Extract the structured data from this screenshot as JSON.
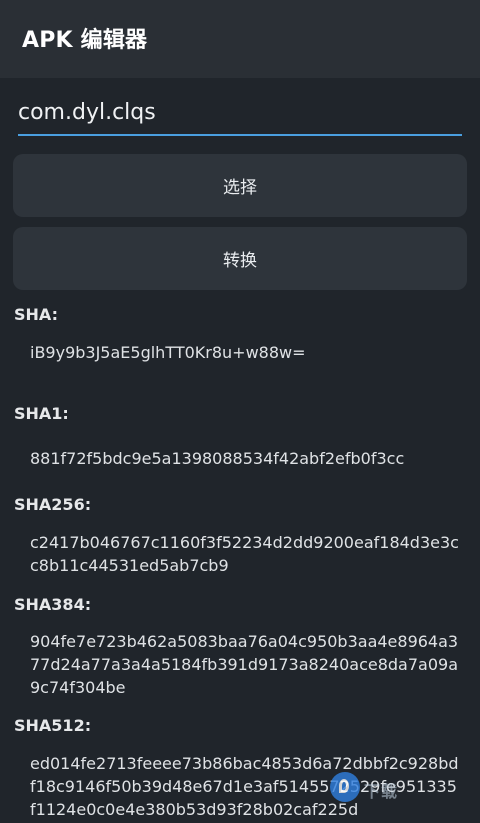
{
  "app_bar": {
    "title": "APK 编辑器"
  },
  "package_input": {
    "value": "com.dyl.clqs"
  },
  "buttons": {
    "select_label": "选择",
    "convert_label": "转换"
  },
  "hashes": [
    {
      "label": "SHA:",
      "value": "iB9y9b3J5aE5glhTT0Kr8u+w88w="
    },
    {
      "label": "SHA1:",
      "value": "881f72f5bdc9e5a1398088534f42abf2efb0f3cc"
    },
    {
      "label": "SHA256:",
      "value": "c2417b046767c1160f3f52234d2dd9200eaf184d3e3cc8b11c44531ed5ab7cb9"
    },
    {
      "label": "SHA384:",
      "value": "904fe7e723b462a5083baa76a04c950b3aa4e8964a377d24a77a3a4a5184fb391d9173a8240ace8da7a09a9c74f304be"
    },
    {
      "label": "SHA512:",
      "value": "ed014fe2713feeee73b86bac4853d6a72dbbf2c928bdf18c9146f50b39d48e67d1e3af5145572529fe951335f1124e0c0e4e380b53d93f28b02caf225d"
    }
  ],
  "watermark": {
    "icon": "download-site-logo-icon",
    "text": "下载"
  }
}
